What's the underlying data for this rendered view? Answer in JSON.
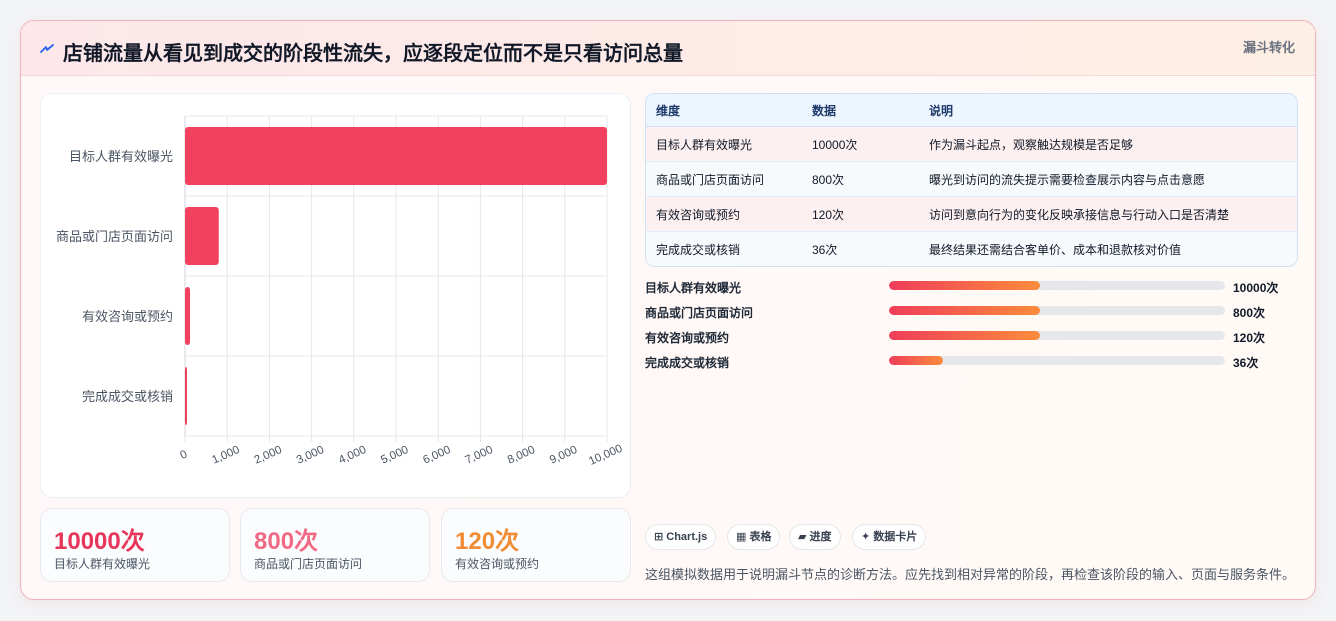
{
  "header": {
    "title": "店铺流量从看见到成交的阶段性流失，应逐段定位而不是只看访问总量",
    "tag": "漏斗转化",
    "icon": "lightning-icon"
  },
  "colors": {
    "bar": "#f2415f",
    "accent_red": "#e8365a",
    "accent_pink": "#f06a85",
    "accent_orange": "#f08c34"
  },
  "chart_data": {
    "type": "bar",
    "orientation": "horizontal",
    "categories": [
      "目标人群有效曝光",
      "商品或门店页面访问",
      "有效咨询或预约",
      "完成成交或核销"
    ],
    "values": [
      10000,
      800,
      120,
      36
    ],
    "xlim": [
      0,
      10000
    ],
    "xticks": [
      "0",
      "1,000",
      "2,000",
      "3,000",
      "4,000",
      "5,000",
      "6,000",
      "7,000",
      "8,000",
      "9,000",
      "10,000"
    ],
    "xlabel": "",
    "ylabel": "",
    "title": "",
    "grid": true
  },
  "table": {
    "headers": [
      "维度",
      "数据",
      "说明"
    ],
    "rows": [
      [
        "目标人群有效曝光",
        "10000次",
        "作为漏斗起点，观察触达规模是否足够"
      ],
      [
        "商品或门店页面访问",
        "800次",
        "曝光到访问的流失提示需要检查展示内容与点击意愿"
      ],
      [
        "有效咨询或预约",
        "120次",
        "访问到意向行为的变化反映承接信息与行动入口是否清楚"
      ],
      [
        "完成成交或核销",
        "36次",
        "最终结果还需结合客单价、成本和退款核对价值"
      ]
    ]
  },
  "progress": [
    {
      "label": "目标人群有效曝光",
      "value": "10000次",
      "fraction": 0.45
    },
    {
      "label": "商品或门店页面访问",
      "value": "800次",
      "fraction": 0.45
    },
    {
      "label": "有效咨询或预约",
      "value": "120次",
      "fraction": 0.45
    },
    {
      "label": "完成成交或核销",
      "value": "36次",
      "fraction": 0.16
    }
  ],
  "kpis": [
    {
      "value": "10000次",
      "label": "目标人群有效曝光"
    },
    {
      "value": "800次",
      "label": "商品或门店页面访问"
    },
    {
      "value": "120次",
      "label": "有效咨询或预约"
    }
  ],
  "chips": [
    {
      "label": "⊞ Chart.js",
      "icon": "chart-grid-icon"
    },
    {
      "label": "▦ 表格",
      "icon": "table-icon"
    },
    {
      "label": "▰ 进度",
      "icon": "progress-icon"
    },
    {
      "label": "✦ 数据卡片",
      "icon": "sparkle-icon"
    }
  ],
  "note": "这组模拟数据用于说明漏斗节点的诊断方法。应先找到相对异常的阶段，再检查该阶段的输入、页面与服务条件。"
}
